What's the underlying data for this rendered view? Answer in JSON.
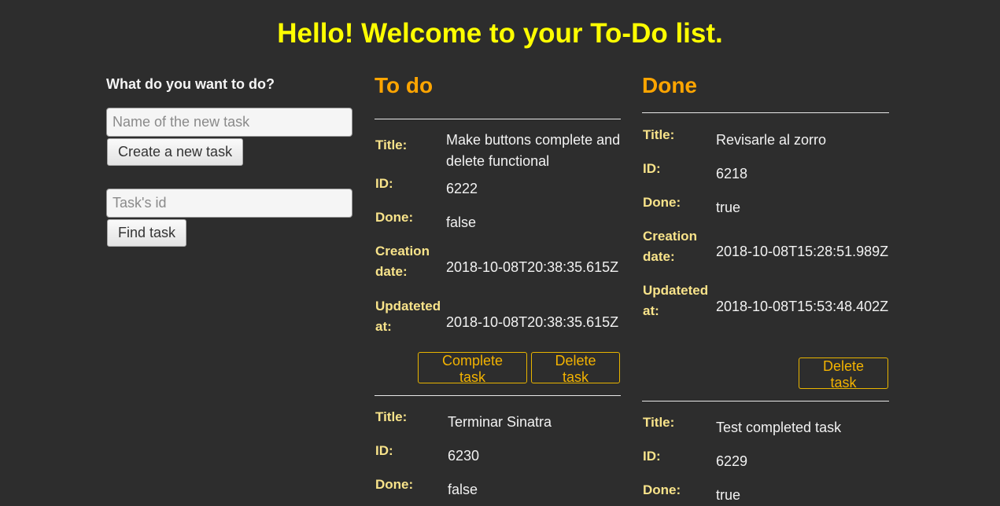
{
  "colors": {
    "background": "#2d2d2d",
    "title": "#ffff00",
    "heading": "#ffa500",
    "field_label": "#f8e38a",
    "value_text": "#f2f2f2",
    "button_outline": "#f3b300"
  },
  "page_title": "Hello! Welcome to your To-Do list.",
  "sidebar": {
    "heading": "What do you want to do?",
    "new_task_placeholder": "Name of the new task",
    "create_button": "Create a new task",
    "task_id_placeholder": "Task's id",
    "find_button": "Find task"
  },
  "field_labels": {
    "title": "Title:",
    "id": "ID:",
    "done": "Done:",
    "creation_date": "Creation date:",
    "updated_at": "Updateted at:"
  },
  "todo": {
    "heading": "To do",
    "complete_label": "Complete task",
    "delete_label": "Delete task",
    "tasks": [
      {
        "title": "Make buttons complete and delete functional",
        "id": "6222",
        "done": "false",
        "creation_date": "2018-10-08T20:38:35.615Z",
        "updated_at": "2018-10-08T20:38:35.615Z"
      },
      {
        "title": "Terminar Sinatra",
        "id": "6230",
        "done": "false"
      }
    ]
  },
  "done": {
    "heading": "Done",
    "delete_label": "Delete task",
    "tasks": [
      {
        "title": "Revisarle al zorro",
        "id": "6218",
        "done": "true",
        "creation_date": "2018-10-08T15:28:51.989Z",
        "updated_at": "2018-10-08T15:53:48.402Z"
      },
      {
        "title": "Test completed task",
        "id": "6229",
        "done": "true"
      }
    ]
  }
}
